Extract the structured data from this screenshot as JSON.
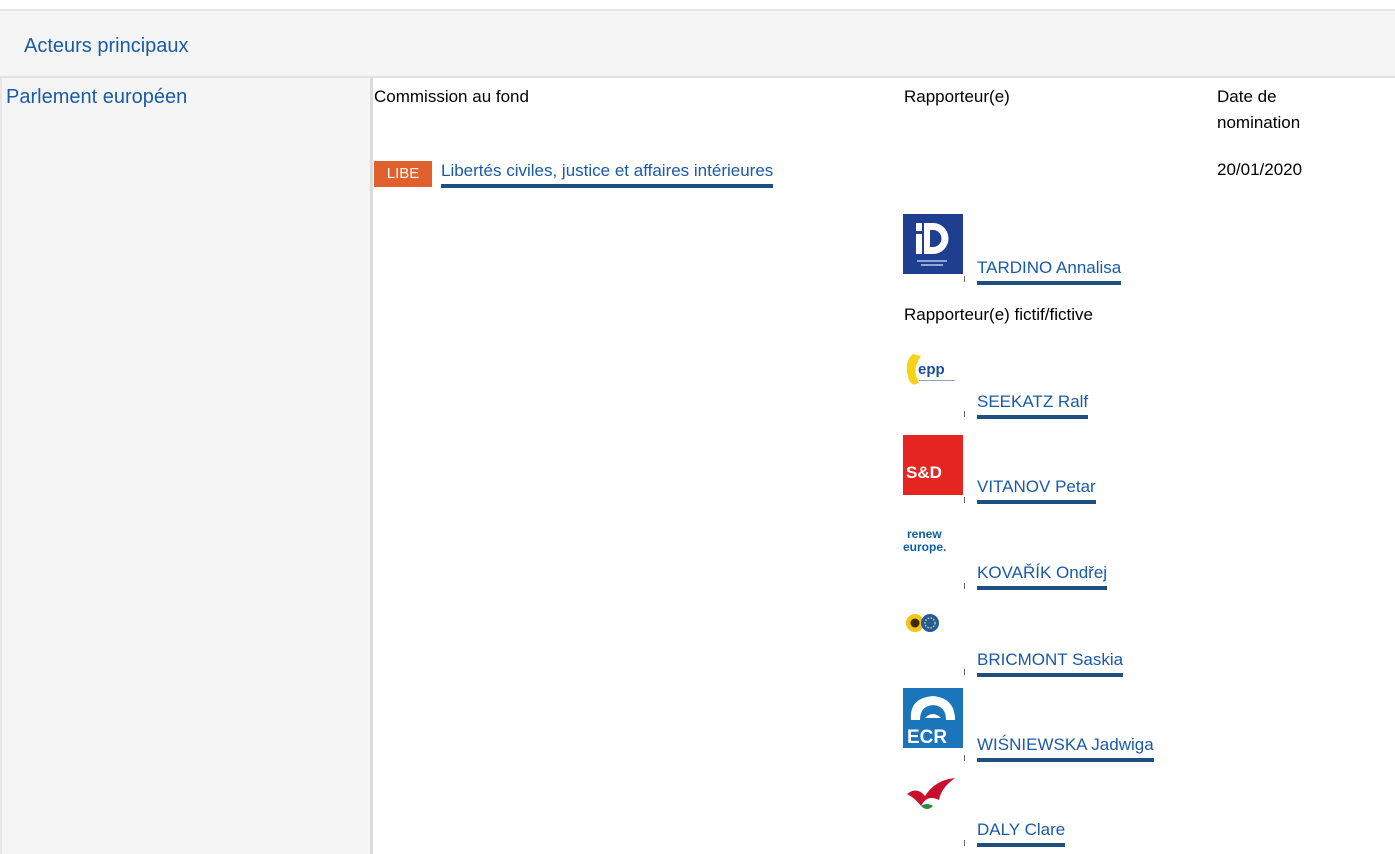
{
  "section_title": "Acteurs principaux",
  "institution": "Parlement européen",
  "columns": {
    "committee": "Commission au fond",
    "rapporteur": "Rapporteur(e)",
    "date_line1": "Date de",
    "date_line2": "nomination"
  },
  "committee": {
    "badge": "LIBE",
    "name": "Libertés civiles, justice et affaires intérieures",
    "date": "20/01/2020",
    "badge_color": "#e0612d"
  },
  "rapporteur": {
    "name": "TARDINO Annalisa",
    "group_logo": "id-group-logo"
  },
  "shadow_label": "Rapporteur(e) fictif/fictive",
  "shadows": [
    {
      "name": "SEEKATZ Ralf",
      "group_logo": "epp-logo",
      "logo_text": "epp"
    },
    {
      "name": "VITANOV Petar",
      "group_logo": "sd-logo",
      "logo_text": "S&D"
    },
    {
      "name": "KOVAŘÍK Ondřej",
      "group_logo": "renew-europe-logo",
      "logo_text": "renew europe."
    },
    {
      "name": "BRICMONT Saskia",
      "group_logo": "greens-efa-logo",
      "logo_text": ""
    },
    {
      "name": "WIŚNIEWSKA Jadwiga",
      "group_logo": "ecr-logo",
      "logo_text": "ECR"
    },
    {
      "name": "DALY Clare",
      "group_logo": "gue-ngl-logo",
      "logo_text": ""
    }
  ]
}
